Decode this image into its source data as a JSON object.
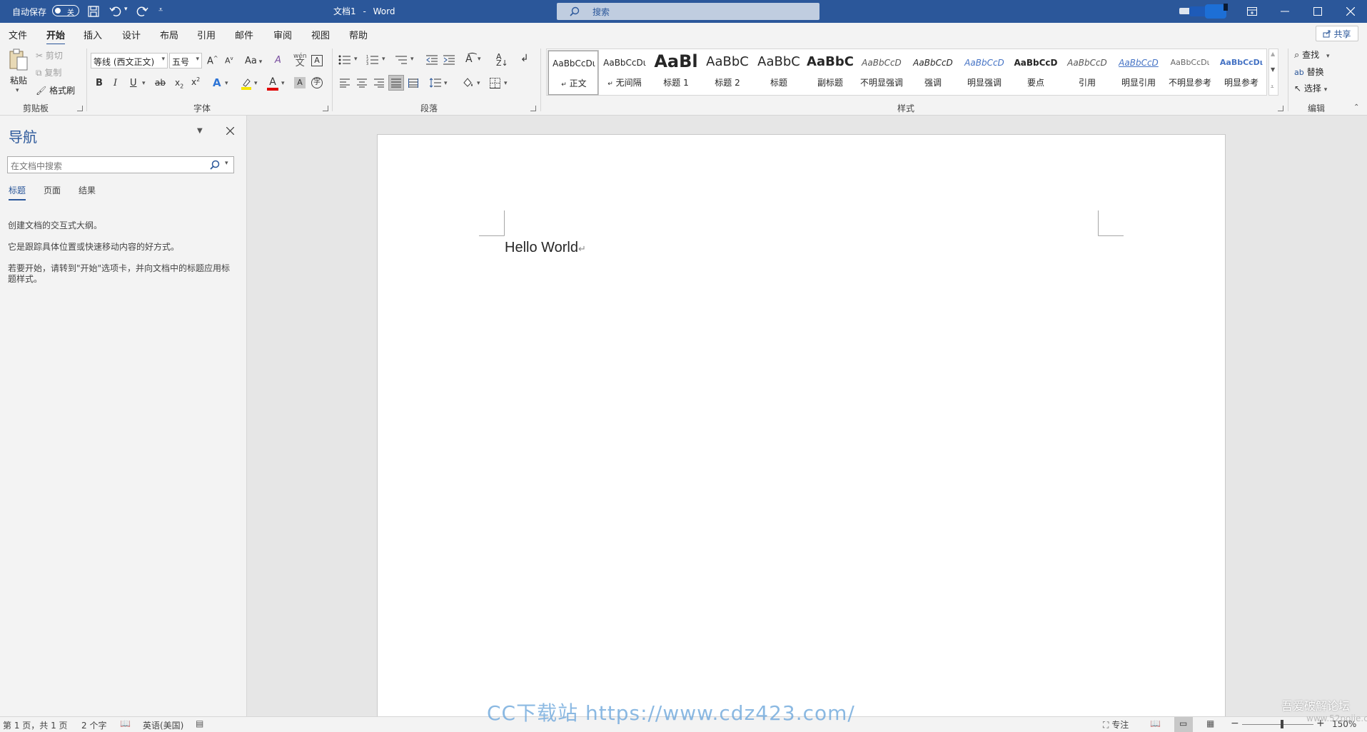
{
  "title_bar": {
    "autosave_label": "自动保存",
    "autosave_state": "关",
    "doc_title": "文档1",
    "separator": "-",
    "app_name": "Word",
    "search_placeholder": "搜索"
  },
  "tabs": [
    {
      "label": "文件"
    },
    {
      "label": "开始",
      "active": true
    },
    {
      "label": "插入"
    },
    {
      "label": "设计"
    },
    {
      "label": "布局"
    },
    {
      "label": "引用"
    },
    {
      "label": "邮件"
    },
    {
      "label": "审阅"
    },
    {
      "label": "视图"
    },
    {
      "label": "帮助"
    }
  ],
  "share_label": "共享",
  "clipboard": {
    "paste": "粘贴",
    "cut": "剪切",
    "copy": "复制",
    "format_painter": "格式刷",
    "group_label": "剪贴板"
  },
  "font": {
    "font_name": "等线 (西文正文)",
    "font_size": "五号",
    "aa_label": "Aa",
    "group_label": "字体"
  },
  "paragraph": {
    "group_label": "段落"
  },
  "styles": {
    "group_label": "样式",
    "items": [
      {
        "preview": "AaBbCcDι",
        "name": "正文",
        "marker": "↵",
        "selected": true
      },
      {
        "preview": "AaBbCcDι",
        "name": "无间隔",
        "marker": "↵"
      },
      {
        "preview": "AaBl",
        "name": "标题 1"
      },
      {
        "preview": "AaBbC",
        "name": "标题 2"
      },
      {
        "preview": "AaBbC",
        "name": "标题"
      },
      {
        "preview": "AaBbC",
        "name": "副标题"
      },
      {
        "preview": "AaBbCcD",
        "name": "不明显强调"
      },
      {
        "preview": "AaBbCcD",
        "name": "强调"
      },
      {
        "preview": "AaBbCcD",
        "name": "明显强调"
      },
      {
        "preview": "AaBbCcD",
        "name": "要点"
      },
      {
        "preview": "AaBbCcD",
        "name": "引用"
      },
      {
        "preview": "AaBbCcD",
        "name": "明显引用"
      },
      {
        "preview": "AaBbCcDι",
        "name": "不明显参考"
      },
      {
        "preview": "AaBbCcDι",
        "name": "明显参考"
      }
    ]
  },
  "editing": {
    "find": "查找",
    "replace": "替换",
    "select": "选择",
    "group_label": "编辑"
  },
  "navigation": {
    "title": "导航",
    "search_placeholder": "在文档中搜索",
    "tabs": [
      {
        "label": "标题",
        "active": true
      },
      {
        "label": "页面"
      },
      {
        "label": "结果"
      }
    ],
    "info_line1": "创建文档的交互式大纲。",
    "info_line2": "它是跟踪具体位置或快速移动内容的好方式。",
    "info_line3": "若要开始，请转到\"开始\"选项卡，并向文档中的标题应用标题样式。"
  },
  "document": {
    "text": "Hello World",
    "paragraph_mark": "↵"
  },
  "status_bar": {
    "page_info": "第 1 页，共 1 页",
    "word_count": "2 个字",
    "language": "英语(美国)",
    "focus": "专注",
    "zoom": "150%"
  },
  "watermark": {
    "site_text": "CC下载站  https://www.cdz423.com/",
    "forum_text": "吾爱破解论坛",
    "forum_url": "www.52pojie.cn"
  },
  "colors": {
    "brand": "#2b579a",
    "ribbon_bg": "#f3f3f3",
    "canvas": "#e6e6e6"
  }
}
